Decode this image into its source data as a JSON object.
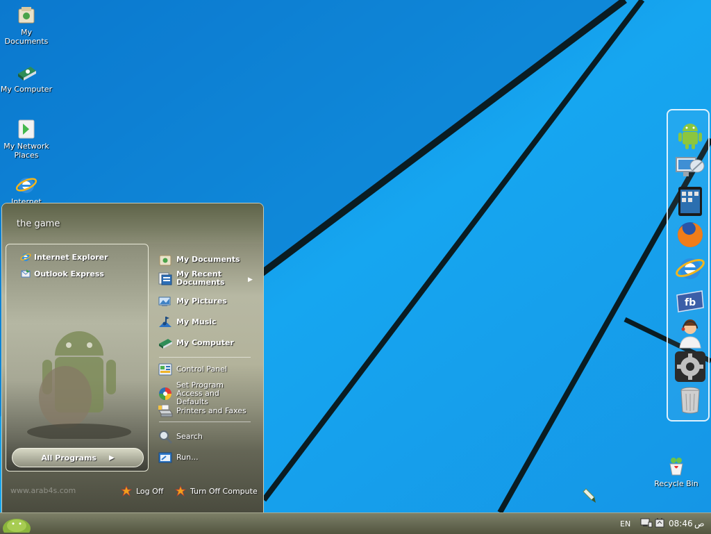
{
  "desktop": {
    "icons": [
      {
        "label": "My Documents",
        "icon": "my-documents-icon"
      },
      {
        "label": "My Computer",
        "icon": "my-computer-icon"
      },
      {
        "label": "My Network Places",
        "icon": "network-places-icon"
      },
      {
        "label": "Internet",
        "icon": "internet-explorer-icon"
      },
      {
        "label": "Recycle Bin",
        "icon": "recycle-bin-icon"
      }
    ]
  },
  "dock": {
    "items": [
      "android-icon",
      "monitor-icon",
      "ipad-icon",
      "firefox-icon",
      "internet-explorer-icon",
      "facebook-icon",
      "support-agent-icon",
      "settings-gear-icon",
      "trash-can-icon"
    ]
  },
  "start_menu": {
    "user_name": "the game",
    "pinned": [
      {
        "label": "Internet Explorer",
        "icon": "internet-explorer-icon"
      },
      {
        "label": "Outlook Express",
        "icon": "outlook-express-icon"
      }
    ],
    "all_programs_label": "All Programs",
    "places": [
      {
        "label": "My Documents",
        "icon": "my-documents-icon"
      },
      {
        "label": "My Recent Documents",
        "icon": "recent-documents-icon"
      },
      {
        "label": "My Pictures",
        "icon": "my-pictures-icon"
      },
      {
        "label": "My Music",
        "icon": "my-music-icon"
      },
      {
        "label": "My Computer",
        "icon": "my-computer-icon"
      }
    ],
    "system": [
      {
        "label": "Control Panel",
        "icon": "control-panel-icon"
      },
      {
        "label": "Set Program Access and Defaults",
        "icon": "program-defaults-icon"
      },
      {
        "label": "Printers and Faxes",
        "icon": "printer-icon"
      }
    ],
    "tools": [
      {
        "label": "Search",
        "icon": "search-icon"
      },
      {
        "label": "Run...",
        "icon": "run-icon"
      }
    ],
    "watermark": "www.arab4s.com",
    "log_off_label": "Log Off",
    "turn_off_label": "Turn Off Compute"
  },
  "taskbar": {
    "language": "EN",
    "time": "08:46",
    "ampm": "ص"
  },
  "colors": {
    "desktop_blue": "#1aa0ec",
    "taskbar": "#676a54",
    "start_menu": "#b7b8a3"
  }
}
